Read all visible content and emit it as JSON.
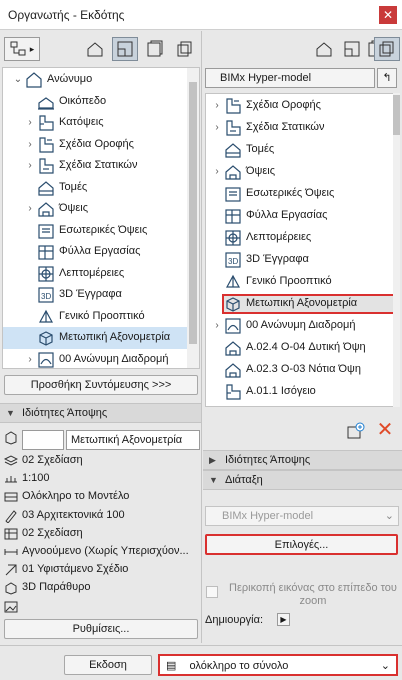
{
  "window": {
    "title": "Οργανωτής - Εκδότης",
    "close_icon": "close-icon"
  },
  "left": {
    "tree": [
      {
        "label": "Ανώνυμο",
        "icon": "project-icon",
        "arrow": "˅",
        "level": 0
      },
      {
        "label": "Οικόπεδο",
        "icon": "site-icon",
        "arrow": "",
        "level": 1
      },
      {
        "label": "Κατόψεις",
        "icon": "floor-plan-icon",
        "arrow": "›",
        "level": 1
      },
      {
        "label": "Σχέδια Οροφής",
        "icon": "ceiling-plan-icon",
        "arrow": "›",
        "level": 1
      },
      {
        "label": "Σχέδια Στατικών",
        "icon": "structural-icon",
        "arrow": "›",
        "level": 1
      },
      {
        "label": "Τομές",
        "icon": "section-icon",
        "arrow": "",
        "level": 1
      },
      {
        "label": "Όψεις",
        "icon": "elevation-icon",
        "arrow": "›",
        "level": 1
      },
      {
        "label": "Εσωτερικές Όψεις",
        "icon": "interior-elevation-icon",
        "arrow": "",
        "level": 1
      },
      {
        "label": "Φύλλα Εργασίας",
        "icon": "worksheet-icon",
        "arrow": "",
        "level": 1
      },
      {
        "label": "Λεπτομέρειες",
        "icon": "detail-icon",
        "arrow": "",
        "level": 1
      },
      {
        "label": "3D Έγγραφα",
        "icon": "3d-document-icon",
        "arrow": "",
        "level": 1
      },
      {
        "label": "Γενικό Προοπτικό",
        "icon": "perspective-icon",
        "arrow": "",
        "level": 1
      },
      {
        "label": "Μετωπική Αξονομετρία",
        "icon": "axonometry-icon",
        "arrow": "",
        "level": 1,
        "selected": true
      },
      {
        "label": "00 Ανώνυμη Διαδρομή",
        "icon": "path-icon",
        "arrow": "›",
        "level": 1
      }
    ],
    "add_shortcut": "Προσθήκη Συντόμευσης >>>",
    "view_props_header": "Ιδιότητες Άποψης",
    "view_id": "",
    "view_name": "Μετωπική Αξονομετρία",
    "props": [
      {
        "icon": "layer-combination-icon",
        "text": "02 Σχεδίαση"
      },
      {
        "icon": "scale-icon",
        "text": "1:100"
      },
      {
        "icon": "model-view-icon",
        "text": "Ολόκληρο το Μοντέλο"
      },
      {
        "icon": "pen-set-icon",
        "text": "03 Αρχιτεκτονικά 100"
      },
      {
        "icon": "model-display-icon",
        "text": "02 Σχεδίαση"
      },
      {
        "icon": "dimension-icon",
        "text": "Αγνοούμενο (Χωρίς Υπερισχύον..."
      },
      {
        "icon": "renovation-icon",
        "text": "01 Υφιστάμενο Σχέδιο"
      },
      {
        "icon": "3d-window-icon",
        "text": "3D Παράθυρο"
      },
      {
        "icon": "image-icon",
        "text": ""
      }
    ],
    "settings_button": "Ρυθμίσεις..."
  },
  "right": {
    "model_selector": "BIMx Hyper-model",
    "tree": [
      {
        "label": "Σχέδια Οροφής",
        "icon": "ceiling-plan-icon",
        "arrow": "›"
      },
      {
        "label": "Σχέδια Στατικών",
        "icon": "structural-icon",
        "arrow": "›"
      },
      {
        "label": "Τομές",
        "icon": "section-icon",
        "arrow": ""
      },
      {
        "label": "Όψεις",
        "icon": "elevation-icon",
        "arrow": "›"
      },
      {
        "label": "Εσωτερικές Όψεις",
        "icon": "interior-elevation-icon",
        "arrow": ""
      },
      {
        "label": "Φύλλα Εργασίας",
        "icon": "worksheet-icon",
        "arrow": ""
      },
      {
        "label": "Λεπτομέρειες",
        "icon": "detail-icon",
        "arrow": ""
      },
      {
        "label": "3D Έγγραφα",
        "icon": "3d-document-icon",
        "arrow": ""
      },
      {
        "label": "Γενικό Προοπτικό",
        "icon": "perspective-icon",
        "arrow": ""
      },
      {
        "label": "Μετωπική Αξονομετρία",
        "icon": "axonometry-icon",
        "arrow": "",
        "highlighted": true
      },
      {
        "label": "00 Ανώνυμη Διαδρομή",
        "icon": "path-icon",
        "arrow": "›"
      },
      {
        "label": "A.02.4 O-04 Δυτική Όψη",
        "icon": "elevation-icon",
        "arrow": ""
      },
      {
        "label": "A.02.3 O-03 Νότια Όψη",
        "icon": "elevation-icon",
        "arrow": ""
      },
      {
        "label": "A.01.1 Ισόγειο",
        "icon": "floor-plan-icon",
        "arrow": ""
      }
    ],
    "view_props_header": "Ιδιότητες Άποψης",
    "layout_header": "Διάταξη",
    "format_selector": "BIMx Hyper-model",
    "options_button": "Επιλογές...",
    "crop_checkbox_label": "Περικοπή εικόνας στο επίπεδο του zoom",
    "create_label": "Δημιουργία:"
  },
  "bottom": {
    "publish_button": "Εκδοση",
    "set_selector": "ολόκληρο το σύνολο"
  },
  "colors": {
    "selection": "#cfe3f5",
    "highlight_border": "#d9302f",
    "delete_red": "#e04a28"
  }
}
